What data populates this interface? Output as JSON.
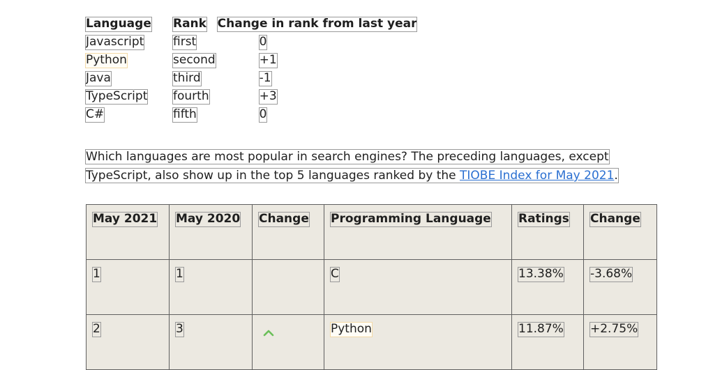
{
  "rank_table": {
    "headers": [
      "Language",
      "Rank",
      "Change in rank from last year"
    ],
    "rows": [
      {
        "language": "Javascript",
        "rank": "first",
        "change": "0"
      },
      {
        "language": "Python",
        "rank": "second",
        "change": "+1"
      },
      {
        "language": "Java",
        "rank": "third",
        "change": "-1"
      },
      {
        "language": "TypeScript",
        "rank": "fourth",
        "change": "+3"
      },
      {
        "language": "C#",
        "rank": "fifth",
        "change": "0"
      }
    ]
  },
  "intro": {
    "line1": "Which languages are most popular in search engines? The preceding languages, except",
    "line2": "TypeScript,  also show up in the top 5 languages ranked by the",
    "link_text": "TIOBE Index for May 2021",
    "end": "."
  },
  "tiobe_table": {
    "headers": [
      "May 2021",
      "May 2020",
      "Change",
      "Programming Language",
      "Ratings",
      "Change"
    ],
    "rows": [
      {
        "may2021": "1",
        "may2020": "1",
        "trend": "",
        "language": "C",
        "ratings": "13.38%",
        "change": "-3.68%"
      },
      {
        "may2021": "2",
        "may2020": "3",
        "trend": "up",
        "language": "Python",
        "ratings": "11.87%",
        "change": "+2.75%"
      }
    ]
  },
  "colors": {
    "link": "#2a6fd1",
    "table_bg": "#ece9e1",
    "up_arrow": "#6bbf59"
  },
  "icons": {
    "trend_up": "chevron-up-icon"
  }
}
